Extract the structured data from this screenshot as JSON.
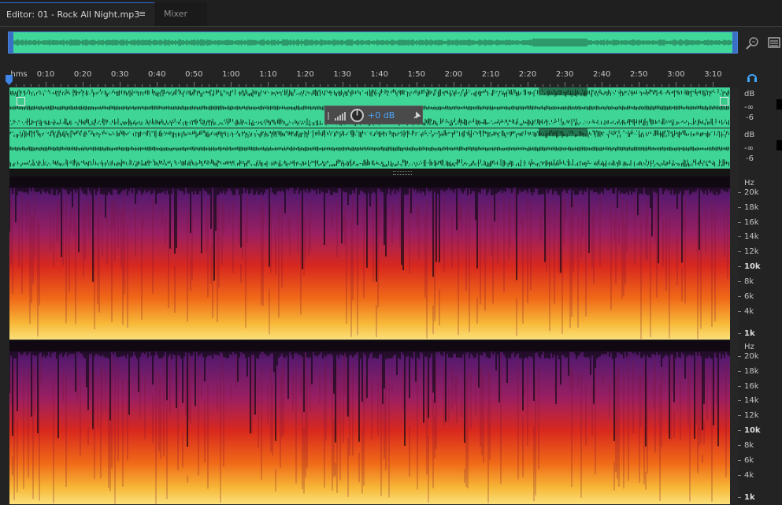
{
  "tabs": [
    {
      "label": "Editor: 01 - Rock All Night.mp3",
      "menu": "≡",
      "active": true
    },
    {
      "label": "Mixer",
      "active": false
    }
  ],
  "ruler": {
    "unit": "hms",
    "ticks": [
      "0:10",
      "0:20",
      "0:30",
      "0:40",
      "0:50",
      "1:00",
      "1:10",
      "1:20",
      "1:30",
      "1:40",
      "1:50",
      "2:00",
      "2:10",
      "2:20",
      "2:30",
      "2:40",
      "2:50",
      "3:00",
      "3:10"
    ]
  },
  "hud": {
    "gain": "+0 dB"
  },
  "db_scale": {
    "unit": "dB",
    "labels": [
      "-∞",
      "-6"
    ]
  },
  "hz_scale": {
    "unit": "Hz",
    "labels": [
      "20k",
      "18k",
      "16k",
      "14k",
      "12k",
      "10k",
      "8k",
      "6k",
      "4k",
      "1k"
    ]
  },
  "colors": {
    "waveform": "#3ed596",
    "waveform_line": "#0e2a1c",
    "accent": "#2f6fd0",
    "hud_text": "#4ea7ff"
  },
  "icons": {
    "zoom": "zoom-magnifier-icon",
    "panel_menu": "panel-menu-icon",
    "headphones": "headphones-icon",
    "pin": "pin-icon",
    "volume": "volume-bars-icon",
    "knob": "gain-knob-icon"
  }
}
